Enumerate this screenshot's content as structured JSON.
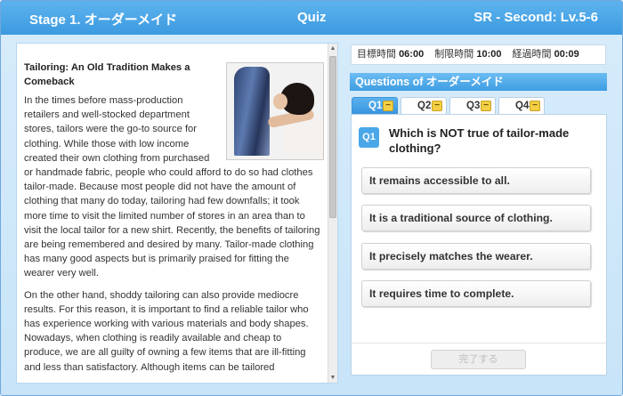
{
  "header": {
    "stage": "Stage 1. オーダーメイド",
    "mode": "Quiz",
    "level": "SR - Second: Lv.5-6"
  },
  "article": {
    "image_icon": "tailor-photo",
    "title": "Tailoring: An Old Tradition Makes a Comeback",
    "paragraph1": "In the times before mass-production retailers and well-stocked department stores, tailors were the go-to source for clothing. While those with low income created their own clothing from purchased or handmade fabric, people who could afford to do so had clothes tailor-made. Because most people did not have the amount of clothing that many do today, tailoring had few downfalls; it took more time to visit the limited number of stores in an area than to visit the local tailor for a new shirt. Recently, the benefits of tailoring are being remembered and desired by many. Tailor-made clothing has many good aspects but is primarily praised for fitting the wearer very well.",
    "paragraph2": "On the other hand, shoddy tailoring can also provide mediocre results. For this reason, it is important to find a reliable tailor who has experience working with various materials and body shapes. Nowadays, when clothing is readily available and cheap to produce, we are all guilty of owning a few items that are ill-fitting and less than satisfactory. Although items can be tailored"
  },
  "scrollbar": {
    "up_icon": "▲",
    "down_icon": "▼"
  },
  "timer": {
    "target_label": "目標時間",
    "target_value": "06:00",
    "limit_label": "制限時間",
    "limit_value": "10:00",
    "elapsed_label": "経過時間",
    "elapsed_value": "00:09"
  },
  "questions": {
    "header": "Questions of オーダーメイド",
    "tabs": [
      {
        "label": "Q1",
        "icon": "−"
      },
      {
        "label": "Q2",
        "icon": "−"
      },
      {
        "label": "Q3",
        "icon": "−"
      },
      {
        "label": "Q4",
        "icon": "−"
      }
    ],
    "active_tab": "Q1",
    "current": {
      "badge": "Q1",
      "text": "Which is NOT true of tailor-made clothing?",
      "options": [
        "It remains accessible to all.",
        "It is a traditional source of clothing.",
        "It precisely matches the wearer.",
        "It requires time to complete."
      ]
    },
    "complete_button": "完了する"
  },
  "colors": {
    "header_blue": "#3c9ae0",
    "tab_active": "#3894de",
    "minus_badge": "#f2cf45",
    "background": "#c8e4f8"
  }
}
